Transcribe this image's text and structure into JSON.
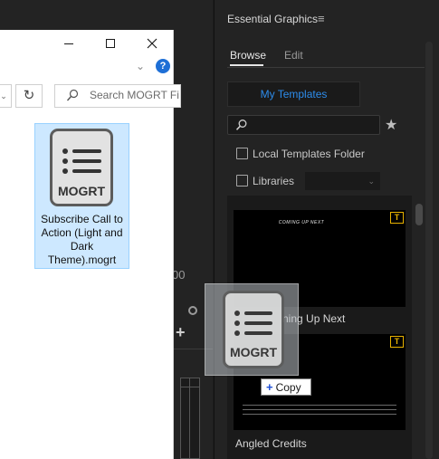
{
  "explorer": {
    "window_buttons": {
      "minimize": "—",
      "maximize": "☐",
      "close": "✕"
    },
    "help": "?",
    "expand_chevron": "⌄",
    "nav_dropdown": "⌄",
    "refresh": "↻",
    "search": {
      "placeholder": "Search MOGRT Fi",
      "value": ""
    },
    "file": {
      "icon_text": "MOGRT",
      "label": "Subscribe Call to Action (Light and Dark Theme).mogrt",
      "selected": true
    }
  },
  "premiere_bg": {
    "partial_number": "00",
    "add_symbol": "+"
  },
  "essential_graphics": {
    "title": "Essential Graphics",
    "menu_icon": "≡",
    "tabs": [
      {
        "label": "Browse",
        "active": true
      },
      {
        "label": "Edit",
        "active": false
      }
    ],
    "my_templates_button": "My Templates",
    "search": {
      "placeholder": "",
      "value": ""
    },
    "favorite_icon": "★",
    "local_templates": {
      "label": "Local Templates Folder",
      "checked": false
    },
    "libraries": {
      "label": "Libraries",
      "checked": false,
      "selected": "",
      "arrow": "⌄"
    },
    "templates": [
      {
        "name": "Coming Up Next",
        "visible_name": "ning Up Next",
        "badge": "T",
        "thumb_text": "COMING UP NEXT"
      },
      {
        "name": "Angled Credits",
        "visible_name": "Angled Credits",
        "badge": "T"
      }
    ]
  },
  "drag": {
    "icon_text": "MOGRT",
    "tooltip_plus": "+",
    "tooltip_label": "Copy"
  },
  "colors": {
    "panel_bg": "#232323",
    "accent_blue": "#2d8ceb",
    "selection_bg": "#cde8ff",
    "badge_yellow": "#e8b200"
  }
}
